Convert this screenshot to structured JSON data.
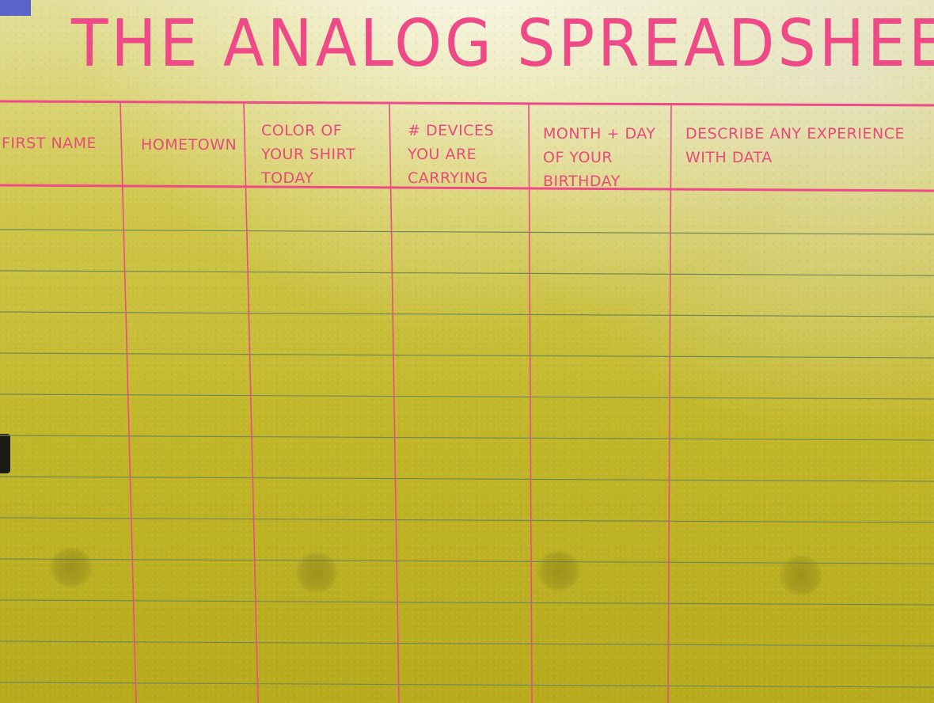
{
  "sheet": {
    "title": "THE ANALOG SPREADSHEET",
    "columns": [
      {
        "label": "FIRST NAME"
      },
      {
        "label": "HOMETOWN"
      },
      {
        "label": "COLOR OF YOUR SHIRT TODAY"
      },
      {
        "label": "# DEVICES YOU ARE CARRYING"
      },
      {
        "label": "MONTH + DAY OF YOUR BIRTHDAY"
      },
      {
        "label": "DESCRIBE ANY EXPERIENCE WITH DATA"
      }
    ],
    "colors": {
      "paper": "#c9bf33",
      "ink_red": "#ee4a88",
      "rule_line": "#6f8a55"
    }
  }
}
